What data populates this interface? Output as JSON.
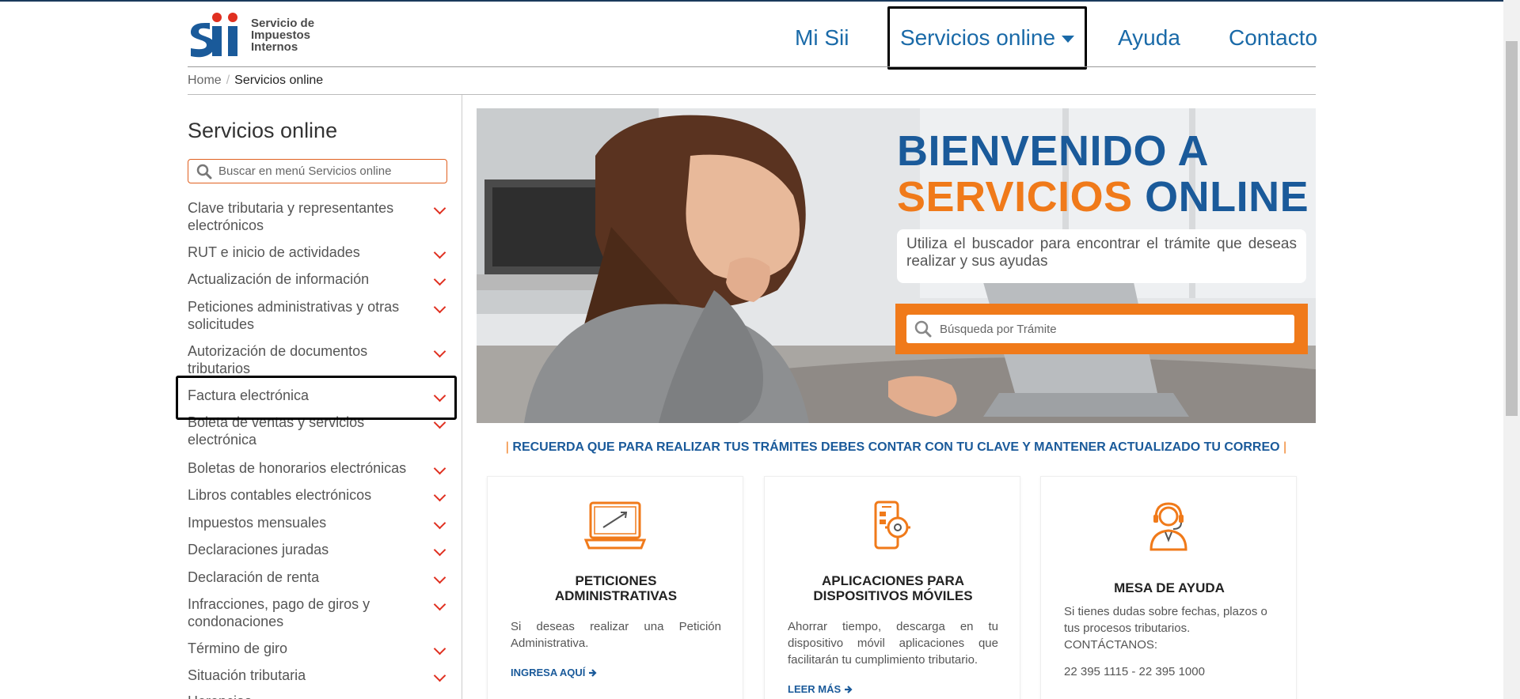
{
  "header": {
    "logo": {
      "line1": "Servicio de",
      "line2": "Impuestos",
      "line3": "Internos"
    },
    "nav": {
      "mi_sii": "Mi Sii",
      "servicios_online": "Servicios online",
      "ayuda": "Ayuda",
      "contacto": "Contacto"
    }
  },
  "breadcrumb": {
    "home": "Home",
    "separator": "/",
    "current": "Servicios online"
  },
  "sidebar": {
    "title": "Servicios online",
    "search_placeholder": "Buscar en menú Servicios online",
    "items": [
      {
        "label": "Clave tributaria y representantes electrónicos"
      },
      {
        "label": "RUT e inicio de actividades"
      },
      {
        "label": "Actualización de información"
      },
      {
        "label": "Peticiones administrativas y otras solicitudes"
      },
      {
        "label": "Autorización de documentos tributarios"
      },
      {
        "label": "Factura electrónica"
      },
      {
        "label": "Boleta de ventas y servicios electrónica"
      },
      {
        "label": "Boletas de honorarios electrónicas"
      },
      {
        "label": "Libros contables electrónicos"
      },
      {
        "label": "Impuestos mensuales"
      },
      {
        "label": "Declaraciones juradas"
      },
      {
        "label": "Declaración de renta"
      },
      {
        "label": "Infracciones, pago de giros y condonaciones"
      },
      {
        "label": "Término de giro"
      },
      {
        "label": "Situación tributaria"
      },
      {
        "label": "Herencias"
      }
    ]
  },
  "hero": {
    "title_line1": "BIENVENIDO A",
    "title_line2_orange": "SERVICIOS",
    "title_line2_blue": "ONLINE",
    "subtitle": "Utiliza el buscador para encontrar el trámite que deseas realizar y sus ayudas",
    "search_placeholder": "Búsqueda por Trámite"
  },
  "notice": {
    "bar_left": "|",
    "text": "RECUERDA QUE PARA REALIZAR TUS TRÁMITES DEBES CONTAR CON TU CLAVE Y MANTENER ACTUALIZADO TU CORREO",
    "bar_right": "|"
  },
  "cards": [
    {
      "title_line1": "PETICIONES",
      "title_line2": "ADMINISTRATIVAS",
      "body": "Si deseas realizar una Petición Administrativa.",
      "link": "INGRESA AQUÍ"
    },
    {
      "title_line1": "APLICACIONES PARA",
      "title_line2": "DISPOSITIVOS MÓVILES",
      "body": "Ahorrar tiempo, descarga en tu dispositivo móvil aplicaciones que facilitarán tu cumplimiento tributario.",
      "link": "LEER MÁS"
    },
    {
      "title_line1": "MESA DE AYUDA",
      "body": "Si tienes dudas sobre fechas, plazos o tus procesos tributarios.",
      "body_line2": "CONTÁCTANOS:",
      "phones": "22 395 1115 - 22 395 1000"
    }
  ],
  "colors": {
    "brand_blue": "#1a5a9a",
    "accent_orange": "#f07a1a",
    "chevron_red": "#e03020"
  }
}
